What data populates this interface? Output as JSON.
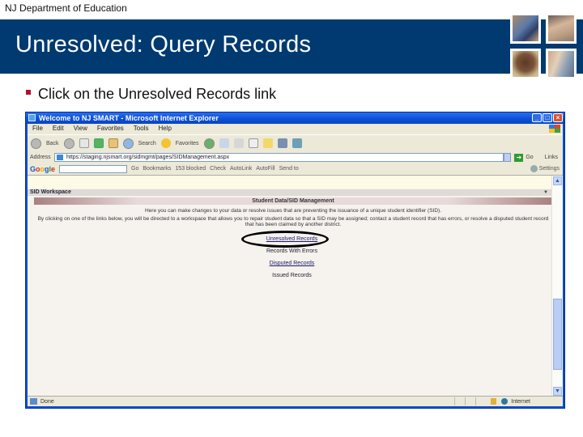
{
  "slide": {
    "organization": "NJ Department of Education",
    "title": "Unresolved:  Query Records",
    "bullet": "Click on the Unresolved Records link",
    "colors": {
      "banner": "#003a70",
      "bullet": "#b0122a",
      "highlight_ellipse": "#000000"
    }
  },
  "browser": {
    "window_title": "Welcome to NJ SMART - Microsoft Internet Explorer",
    "menu": [
      "File",
      "Edit",
      "View",
      "Favorites",
      "Tools",
      "Help"
    ],
    "toolbar": {
      "back": "Back",
      "search": "Search",
      "favorites": "Favorites"
    },
    "address": {
      "label": "Address",
      "url": "https://staging.njsmart.org/sidmgmt/pages/SIDManagement.aspx",
      "go": "Go",
      "links": "Links"
    },
    "google_toolbar": {
      "logo": [
        "G",
        "o",
        "o",
        "g",
        "l",
        "e"
      ],
      "go": "Go",
      "bookmarks": "Bookmarks",
      "blocked": "153 blocked",
      "check": "Check",
      "autolink": "AutoLink",
      "autofill": "AutoFill",
      "send_to": "Send to",
      "settings": "Settings"
    },
    "page": {
      "workspace_header": "SID Workspace",
      "section_header": "Student Data/SID Management",
      "intro": "Here you can make changes to your data or resolve issues that are preventing the issuance of a unique student identifier (SID).",
      "instructions": "By clicking on one of the links below, you will be directed to a workspace that allows you to repair student data so that a SID may be assigned; contact a student record that has errors, or resolve a disputed student record that has been claimed by another district.",
      "links": [
        {
          "label": "Unresolved Records",
          "underlined": true,
          "highlighted": true
        },
        {
          "label": "Records With Errors",
          "underlined": false,
          "highlighted": false
        },
        {
          "label": "Disputed Records",
          "underlined": true,
          "highlighted": false
        },
        {
          "label": "Issued Records",
          "underlined": false,
          "highlighted": false
        }
      ]
    },
    "status": {
      "text": "Done",
      "zone": "Internet"
    }
  }
}
